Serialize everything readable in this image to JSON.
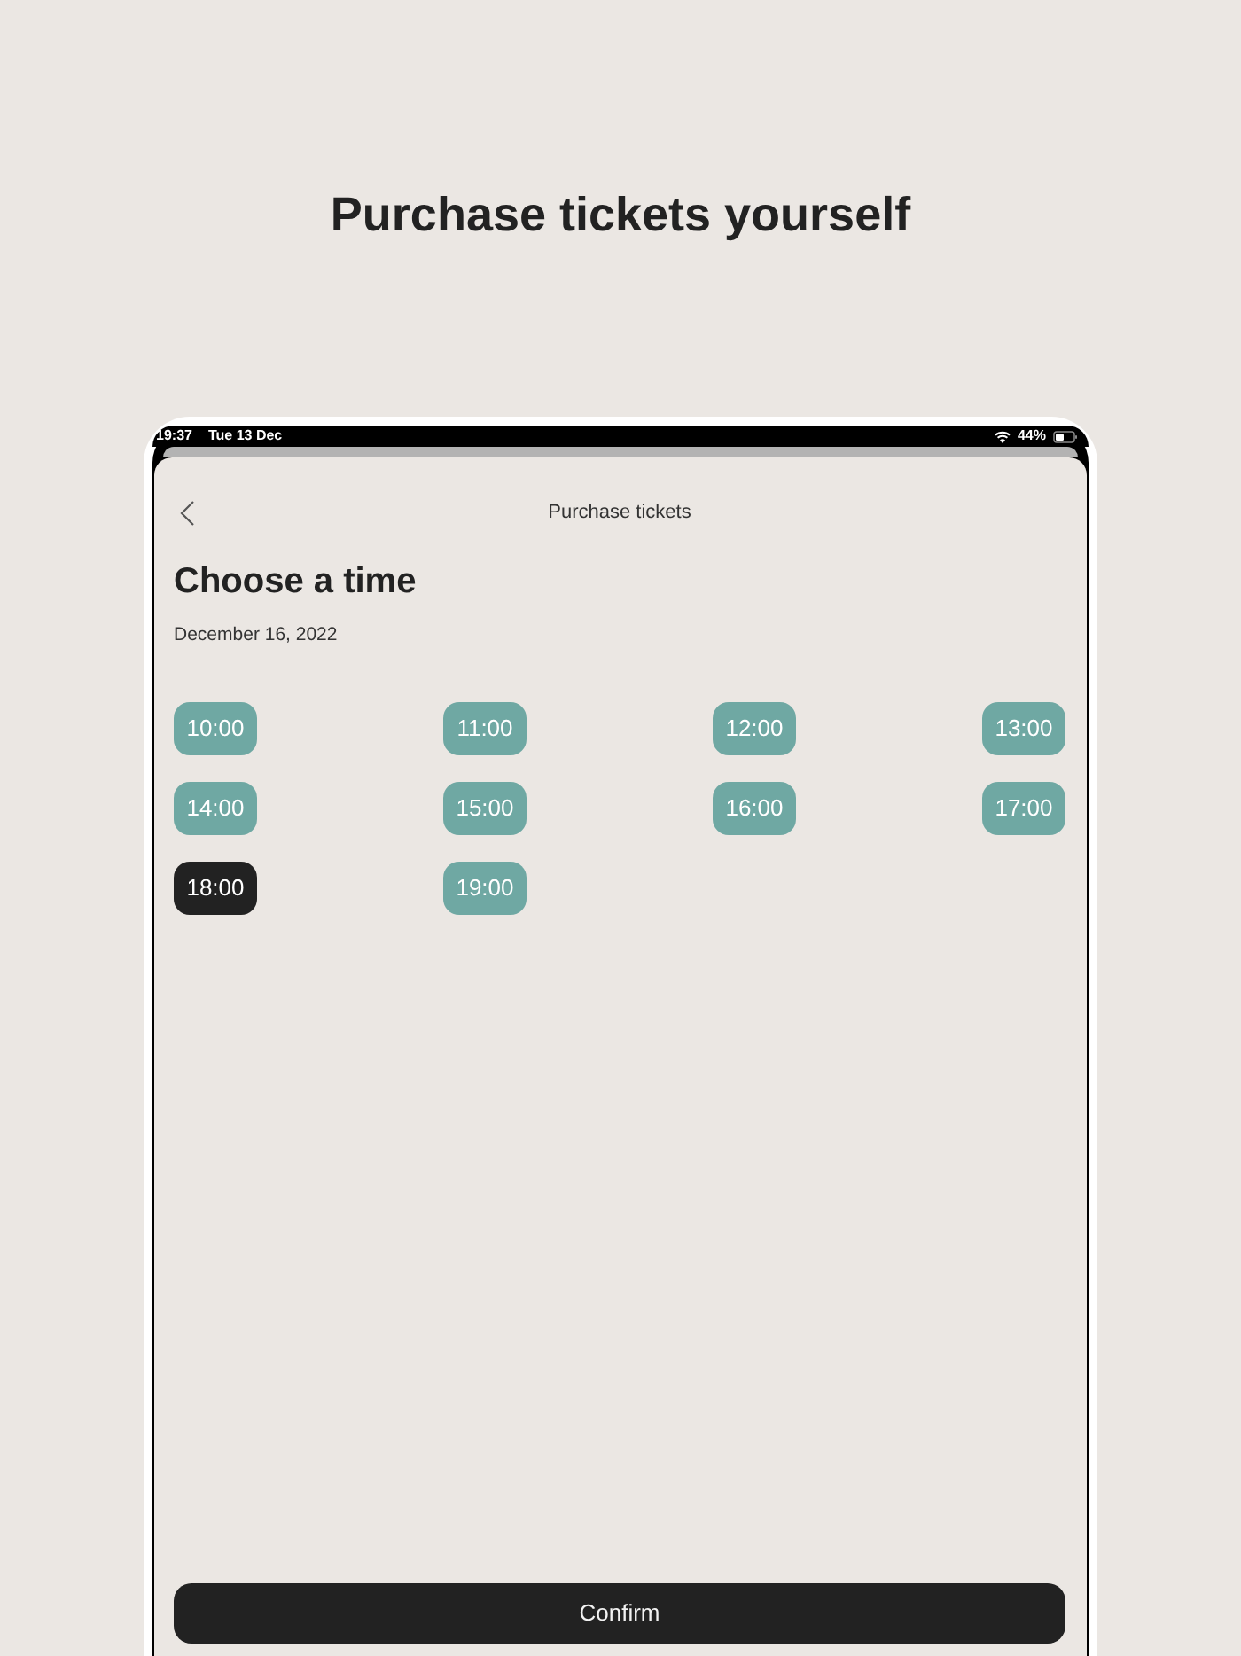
{
  "headline": "Purchase tickets yourself",
  "status_bar": {
    "time": "19:37",
    "date": "Tue 13 Dec",
    "battery": "44%"
  },
  "nav": {
    "title": "Purchase tickets"
  },
  "heading": "Choose a time",
  "date": "December 16, 2022",
  "times": [
    {
      "label": "10:00",
      "selected": false
    },
    {
      "label": "11:00",
      "selected": false
    },
    {
      "label": "12:00",
      "selected": false
    },
    {
      "label": "13:00",
      "selected": false
    },
    {
      "label": "14:00",
      "selected": false
    },
    {
      "label": "15:00",
      "selected": false
    },
    {
      "label": "16:00",
      "selected": false
    },
    {
      "label": "17:00",
      "selected": false
    },
    {
      "label": "18:00",
      "selected": true
    },
    {
      "label": "19:00",
      "selected": false
    }
  ],
  "confirm_button": "Confirm"
}
